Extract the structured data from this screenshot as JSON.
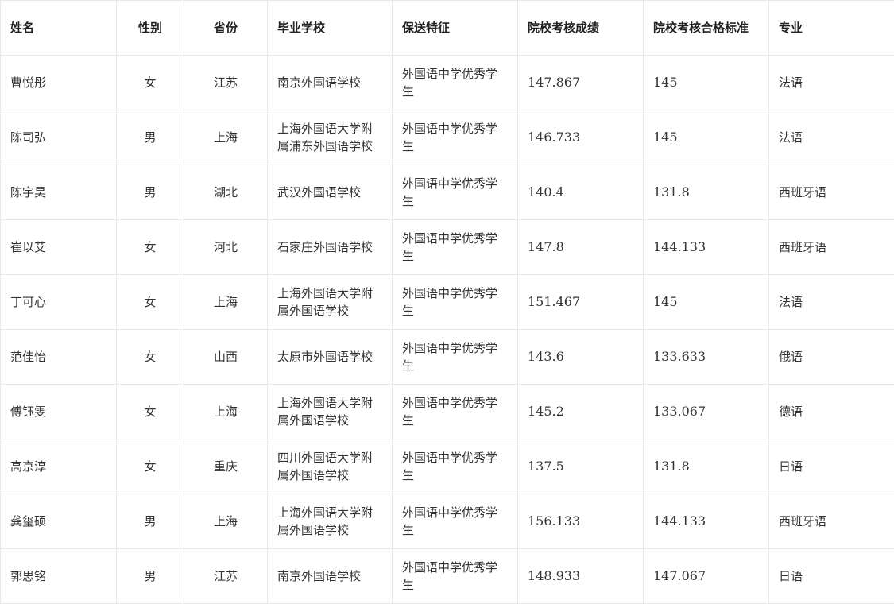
{
  "table": {
    "headers": {
      "name": "姓名",
      "gender": "性别",
      "province": "省份",
      "school": "毕业学校",
      "feature": "保送特征",
      "score": "院校考核成绩",
      "standard": "院校考核合格标准",
      "major": "专业"
    },
    "rows": [
      {
        "name": "曹悦彤",
        "gender": "女",
        "province": "江苏",
        "school": "南京外国语学校",
        "feature": "外国语中学优秀学生",
        "score": "147.867",
        "standard": "145",
        "major": "法语"
      },
      {
        "name": "陈司弘",
        "gender": "男",
        "province": "上海",
        "school": "上海外国语大学附属浦东外国语学校",
        "feature": "外国语中学优秀学生",
        "score": "146.733",
        "standard": "145",
        "major": "法语"
      },
      {
        "name": "陈宇昊",
        "gender": "男",
        "province": "湖北",
        "school": "武汉外国语学校",
        "feature": "外国语中学优秀学生",
        "score": "140.4",
        "standard": "131.8",
        "major": "西班牙语"
      },
      {
        "name": "崔以艾",
        "gender": "女",
        "province": "河北",
        "school": "石家庄外国语学校",
        "feature": "外国语中学优秀学生",
        "score": "147.8",
        "standard": "144.133",
        "major": "西班牙语"
      },
      {
        "name": "丁可心",
        "gender": "女",
        "province": "上海",
        "school": "上海外国语大学附属外国语学校",
        "feature": "外国语中学优秀学生",
        "score": "151.467",
        "standard": "145",
        "major": "法语"
      },
      {
        "name": "范佳怡",
        "gender": "女",
        "province": "山西",
        "school": "太原市外国语学校",
        "feature": "外国语中学优秀学生",
        "score": "143.6",
        "standard": "133.633",
        "major": "俄语"
      },
      {
        "name": "傅钰雯",
        "gender": "女",
        "province": "上海",
        "school": "上海外国语大学附属外国语学校",
        "feature": "外国语中学优秀学生",
        "score": "145.2",
        "standard": "133.067",
        "major": "德语"
      },
      {
        "name": "高京淳",
        "gender": "女",
        "province": "重庆",
        "school": "四川外国语大学附属外国语学校",
        "feature": "外国语中学优秀学生",
        "score": "137.5",
        "standard": "131.8",
        "major": "日语"
      },
      {
        "name": "龚玺硕",
        "gender": "男",
        "province": "上海",
        "school": "上海外国语大学附属外国语学校",
        "feature": "外国语中学优秀学生",
        "score": "156.133",
        "standard": "144.133",
        "major": "西班牙语"
      },
      {
        "name": "郭思铭",
        "gender": "男",
        "province": "江苏",
        "school": "南京外国语学校",
        "feature": "外国语中学优秀学生",
        "score": "148.933",
        "standard": "147.067",
        "major": "日语"
      }
    ]
  }
}
